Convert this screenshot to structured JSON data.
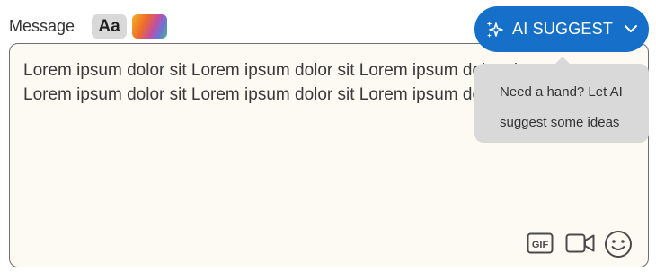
{
  "composer": {
    "label": "Message",
    "format_button_label": "Aa",
    "editor_lines": [
      "Lorem ipsum dolor sit Lorem ipsum dolor sit Lorem ipsum dolor sit",
      "Lorem ipsum dolor sit Lorem ipsum dolor sit Lorem ipsum dolor sit"
    ],
    "tools": [
      "gif-icon",
      "video-icon",
      "emoji-icon"
    ],
    "editor_background": "#fdf9f3",
    "border_color": "#6e6e6e"
  },
  "ai_suggest": {
    "label": "AI SUGGEST",
    "accent": "#1670c9",
    "icon": "sparkle-icon",
    "dropdown_icon": "chevron-down-icon"
  },
  "tooltip": {
    "text": "Need a hand? Let AI suggest some ideas",
    "background": "#d9d9d9"
  }
}
